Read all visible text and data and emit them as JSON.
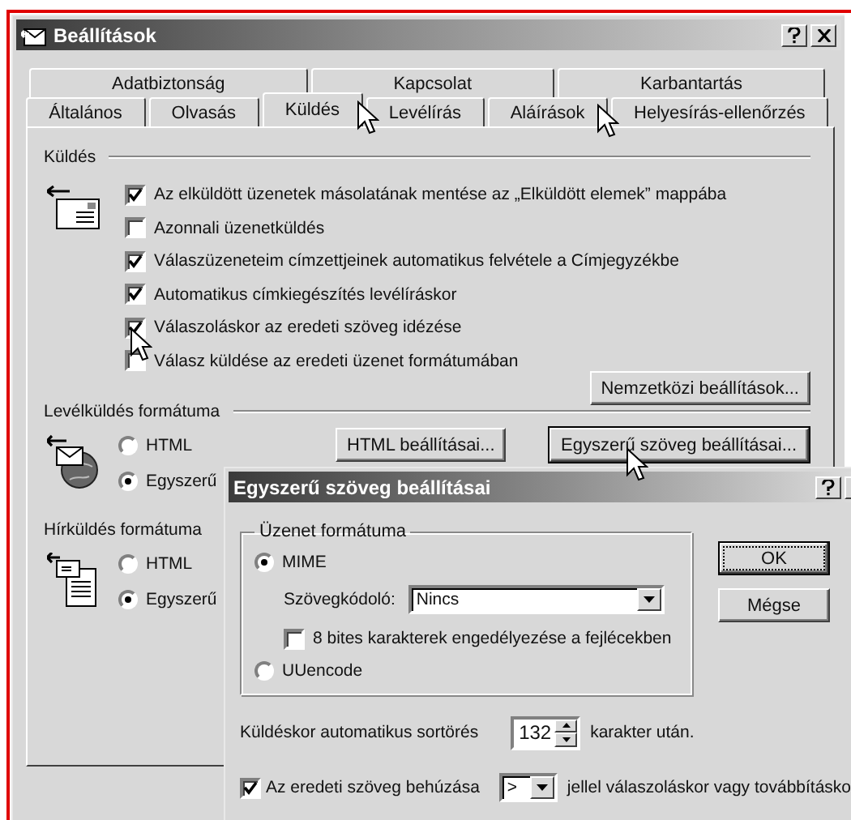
{
  "window": {
    "title": "Beállítások"
  },
  "tab_rows": [
    [
      {
        "label": "Adatbiztonság",
        "selected": false
      },
      {
        "label": "Kapcsolat",
        "selected": false
      },
      {
        "label": "Karbantartás",
        "selected": false
      }
    ],
    [
      {
        "label": "Általános",
        "selected": false
      },
      {
        "label": "Olvasás",
        "selected": false
      },
      {
        "label": "Küldés",
        "selected": true
      },
      {
        "label": "Levélírás",
        "selected": false
      },
      {
        "label": "Aláírások",
        "selected": false
      },
      {
        "label": "Helyesírás-ellenőrzés",
        "selected": false
      }
    ]
  ],
  "send_section": {
    "title": "Küldés",
    "options": [
      {
        "label": "Az elküldött üzenetek másolatának mentése az „Elküldött elemek” mappába",
        "checked": true
      },
      {
        "label": "Azonnali üzenetküldés",
        "checked": false
      },
      {
        "label": "Válaszüzeneteim címzettjeinek automatikus felvétele a Címjegyzékbe",
        "checked": true
      },
      {
        "label": "Automatikus címkiegészítés levélíráskor",
        "checked": true
      },
      {
        "label": "Válaszoláskor az eredeti szöveg idézése",
        "checked": true
      },
      {
        "label": "Válasz küldése az eredeti üzenet formátumában",
        "checked": false
      }
    ],
    "button": "Nemzetközi beállítások..."
  },
  "mail_format": {
    "title": "Levélküldés formátuma",
    "options": [
      {
        "label": "HTML",
        "selected": false
      },
      {
        "label": "Egyszerű",
        "selected": true
      }
    ],
    "buttons": [
      "HTML beállításai...",
      "Egyszerű szöveg beállításai..."
    ]
  },
  "news_format": {
    "title": "Hírküldés formátuma",
    "options": [
      {
        "label": "HTML",
        "selected": false
      },
      {
        "label": "Egyszerű",
        "selected": true
      }
    ]
  },
  "dialog": {
    "title": "Egyszerű szöveg beállításai",
    "group": {
      "title": "Üzenet formátuma",
      "options": [
        {
          "label": "MIME",
          "selected": true
        },
        {
          "label": "UUencode",
          "selected": false
        }
      ],
      "encoder_label": "Szövegkódoló:",
      "encoder_value": "Nincs",
      "eight_bit": {
        "label": "8 bites karakterek engedélyezése a fejlécekben",
        "checked": false
      }
    },
    "buttons": [
      "OK",
      "Mégse"
    ],
    "line_wrap": {
      "label": "Küldéskor automatikus sortörés",
      "value": "132",
      "suffix": "karakter után."
    },
    "indent": {
      "label": "Az eredeti szöveg behúzása",
      "checked": true,
      "value": ">",
      "suffix": "jellel válaszoláskor vagy továbbításko"
    }
  }
}
